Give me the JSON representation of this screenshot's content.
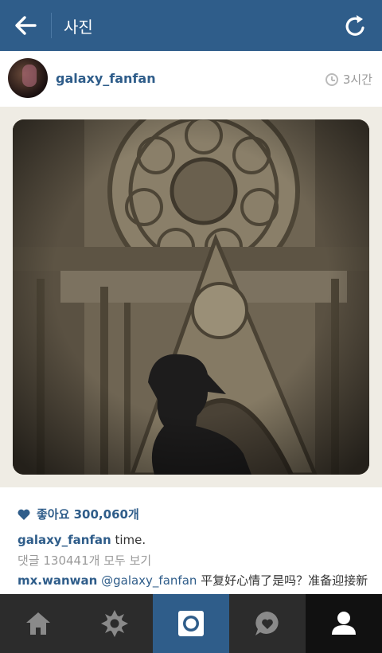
{
  "header": {
    "title": "사진"
  },
  "post": {
    "username": "galaxy_fanfan",
    "time_ago": "3시간",
    "likes_label": "좋아요 300,060개",
    "caption_user": "galaxy_fanfan",
    "caption_text": " time.",
    "view_comments": "댓글 130441개 모두 보기",
    "comment_user": "mx.wanwan",
    "comment_mention": "@galaxy_fanfan",
    "comment_text": " 平复好心情了是吗？准备迎接新"
  },
  "tabs": [
    {
      "name": "home",
      "icon": "home-icon"
    },
    {
      "name": "explore",
      "icon": "explore-star-icon"
    },
    {
      "name": "camera",
      "icon": "camera-icon"
    },
    {
      "name": "activity",
      "icon": "activity-bubble-icon"
    },
    {
      "name": "profile",
      "icon": "profile-icon"
    }
  ],
  "colors": {
    "header": "#2f5d8a",
    "accent": "#2f5d8a",
    "tabbar": "#2c2c2c"
  }
}
